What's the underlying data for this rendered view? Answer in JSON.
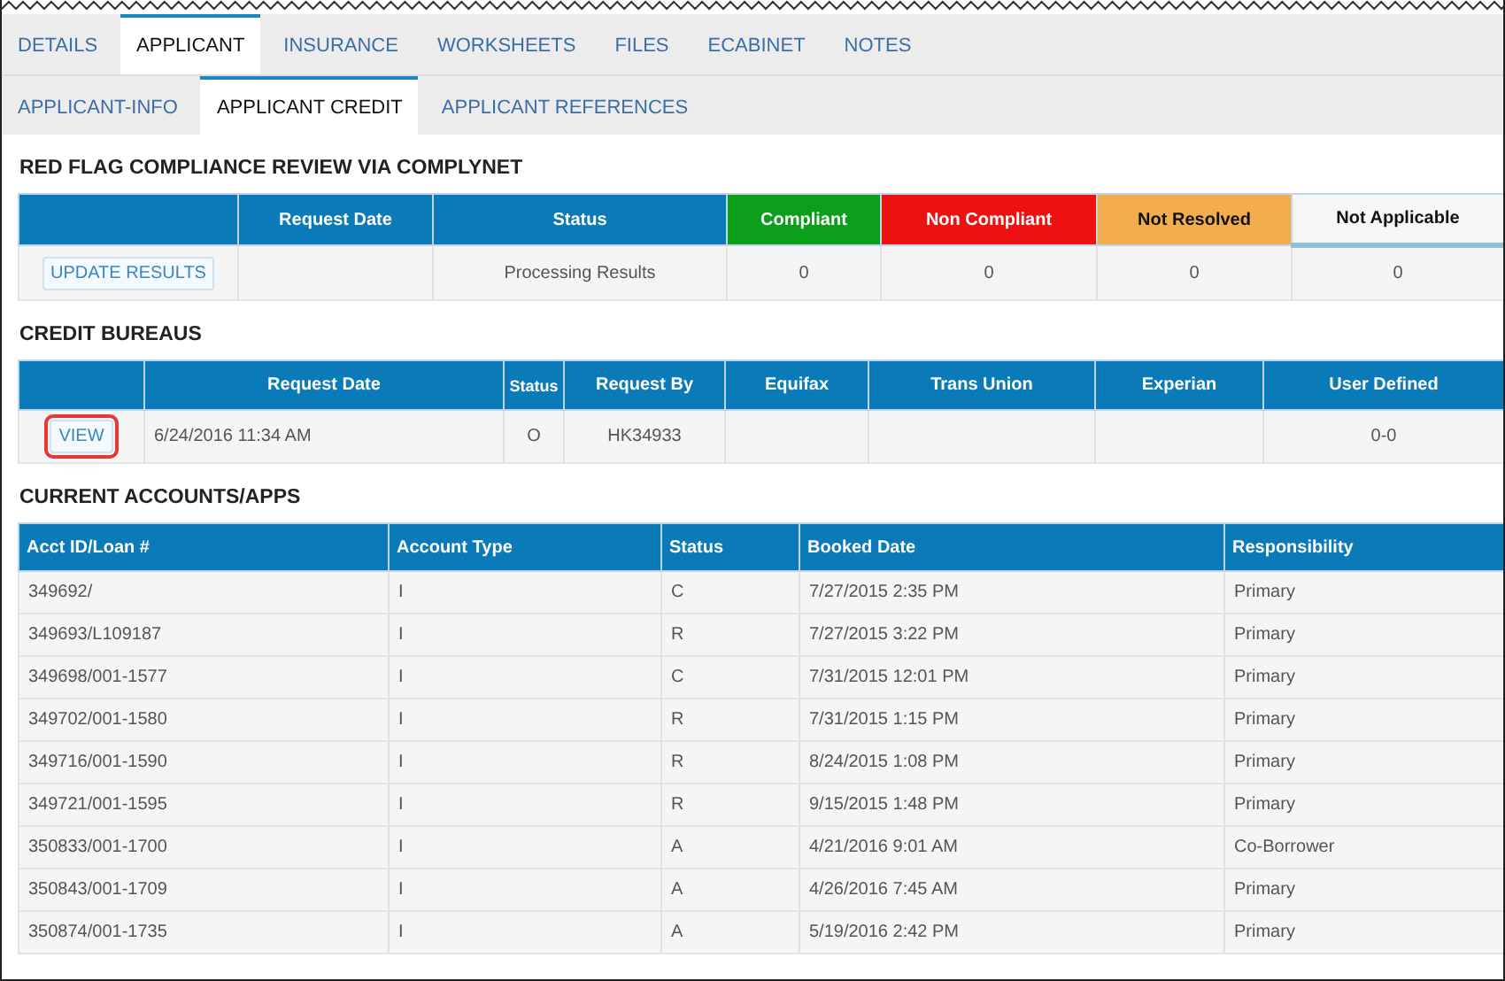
{
  "tabs": [
    {
      "label": "DETAILS",
      "selected": false
    },
    {
      "label": "APPLICANT",
      "selected": true
    },
    {
      "label": "INSURANCE",
      "selected": false
    },
    {
      "label": "WORKSHEETS",
      "selected": false
    },
    {
      "label": "FILES",
      "selected": false
    },
    {
      "label": "ECABINET",
      "selected": false
    },
    {
      "label": "NOTES",
      "selected": false
    }
  ],
  "subtabs": [
    {
      "label": "APPLICANT-INFO",
      "selected": false
    },
    {
      "label": "APPLICANT CREDIT",
      "selected": true
    },
    {
      "label": "APPLICANT REFERENCES",
      "selected": false
    }
  ],
  "compliance": {
    "title": "RED FLAG COMPLIANCE REVIEW VIA COMPLYNET",
    "columns": [
      {
        "color": "#0a7ab8"
      },
      {
        "label": "Request Date",
        "color": "#0a7ab8"
      },
      {
        "label": "Status",
        "color": "#0a7ab8"
      },
      {
        "label": "Compliant",
        "color": "#0a9e1a"
      },
      {
        "label": "Non Compliant",
        "color": "#ee1111"
      },
      {
        "label": "Not Resolved",
        "color": "#f2ae4e"
      },
      {
        "label": "Not Applicable",
        "color": "#f7f7f7"
      }
    ],
    "button": {
      "label": "UPDATE RESULTS"
    },
    "cells": [
      null,
      "Processing Results",
      "0",
      "0",
      "0",
      "0"
    ]
  },
  "credit_bureaus": {
    "title": "CREDIT BUREAUS",
    "columns": [
      null,
      "Request Date",
      "Status",
      "Request By",
      "Equifax",
      "Trans Union",
      "Experian",
      "User Defined"
    ],
    "button": {
      "label": "VIEW",
      "highlighted": true
    },
    "cells": [
      "6/24/2016 11:34 AM",
      "O",
      "HK34933",
      null,
      null,
      null,
      "0-0"
    ]
  },
  "accounts": {
    "title": "CURRENT ACCOUNTS/APPS",
    "columns": [
      "Acct ID/Loan #",
      "Account Type",
      "Status",
      "Booked Date",
      "Responsibility"
    ],
    "rows": [
      [
        "349692/",
        "I",
        "C",
        "7/27/2015 2:35 PM",
        "Primary"
      ],
      [
        "349693/L109187",
        "I",
        "R",
        "7/27/2015 3:22 PM",
        "Primary"
      ],
      [
        "349698/001-1577",
        "I",
        "C",
        "7/31/2015 12:01 PM",
        "Primary"
      ],
      [
        "349702/001-1580",
        "I",
        "R",
        "7/31/2015 1:15 PM",
        "Primary"
      ],
      [
        "349716/001-1590",
        "I",
        "R",
        "8/24/2015 1:08 PM",
        "Primary"
      ],
      [
        "349721/001-1595",
        "I",
        "R",
        "9/15/2015 1:48 PM",
        "Primary"
      ],
      [
        "350833/001-1700",
        "I",
        "A",
        "4/21/2016 9:01 AM",
        "Co-Borrower"
      ],
      [
        "350843/001-1709",
        "I",
        "A",
        "4/26/2016 7:45 AM",
        "Primary"
      ],
      [
        "350874/001-1735",
        "I",
        "A",
        "5/19/2016 2:42 PM",
        "Primary"
      ]
    ]
  }
}
